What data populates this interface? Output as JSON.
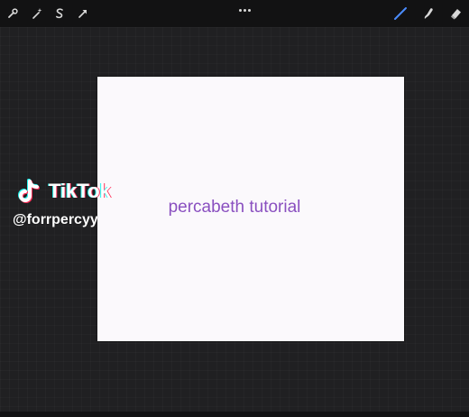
{
  "toolbar": {
    "left_tools": [
      "wrench-icon",
      "magic-wand-icon",
      "selection-s-icon",
      "transform-arrow-icon"
    ],
    "right_tools": [
      "brush-icon",
      "smudge-icon",
      "eraser-icon"
    ],
    "active_tool": "brush-icon",
    "active_color": "#4a8cff",
    "icon_color": "#d8d8d8"
  },
  "canvas": {
    "text": "percabeth tutorial",
    "text_color": "#8a50c0",
    "background": "#fbf9fc"
  },
  "watermark": {
    "brand": "TikTok",
    "handle": "@forrpercyy"
  }
}
